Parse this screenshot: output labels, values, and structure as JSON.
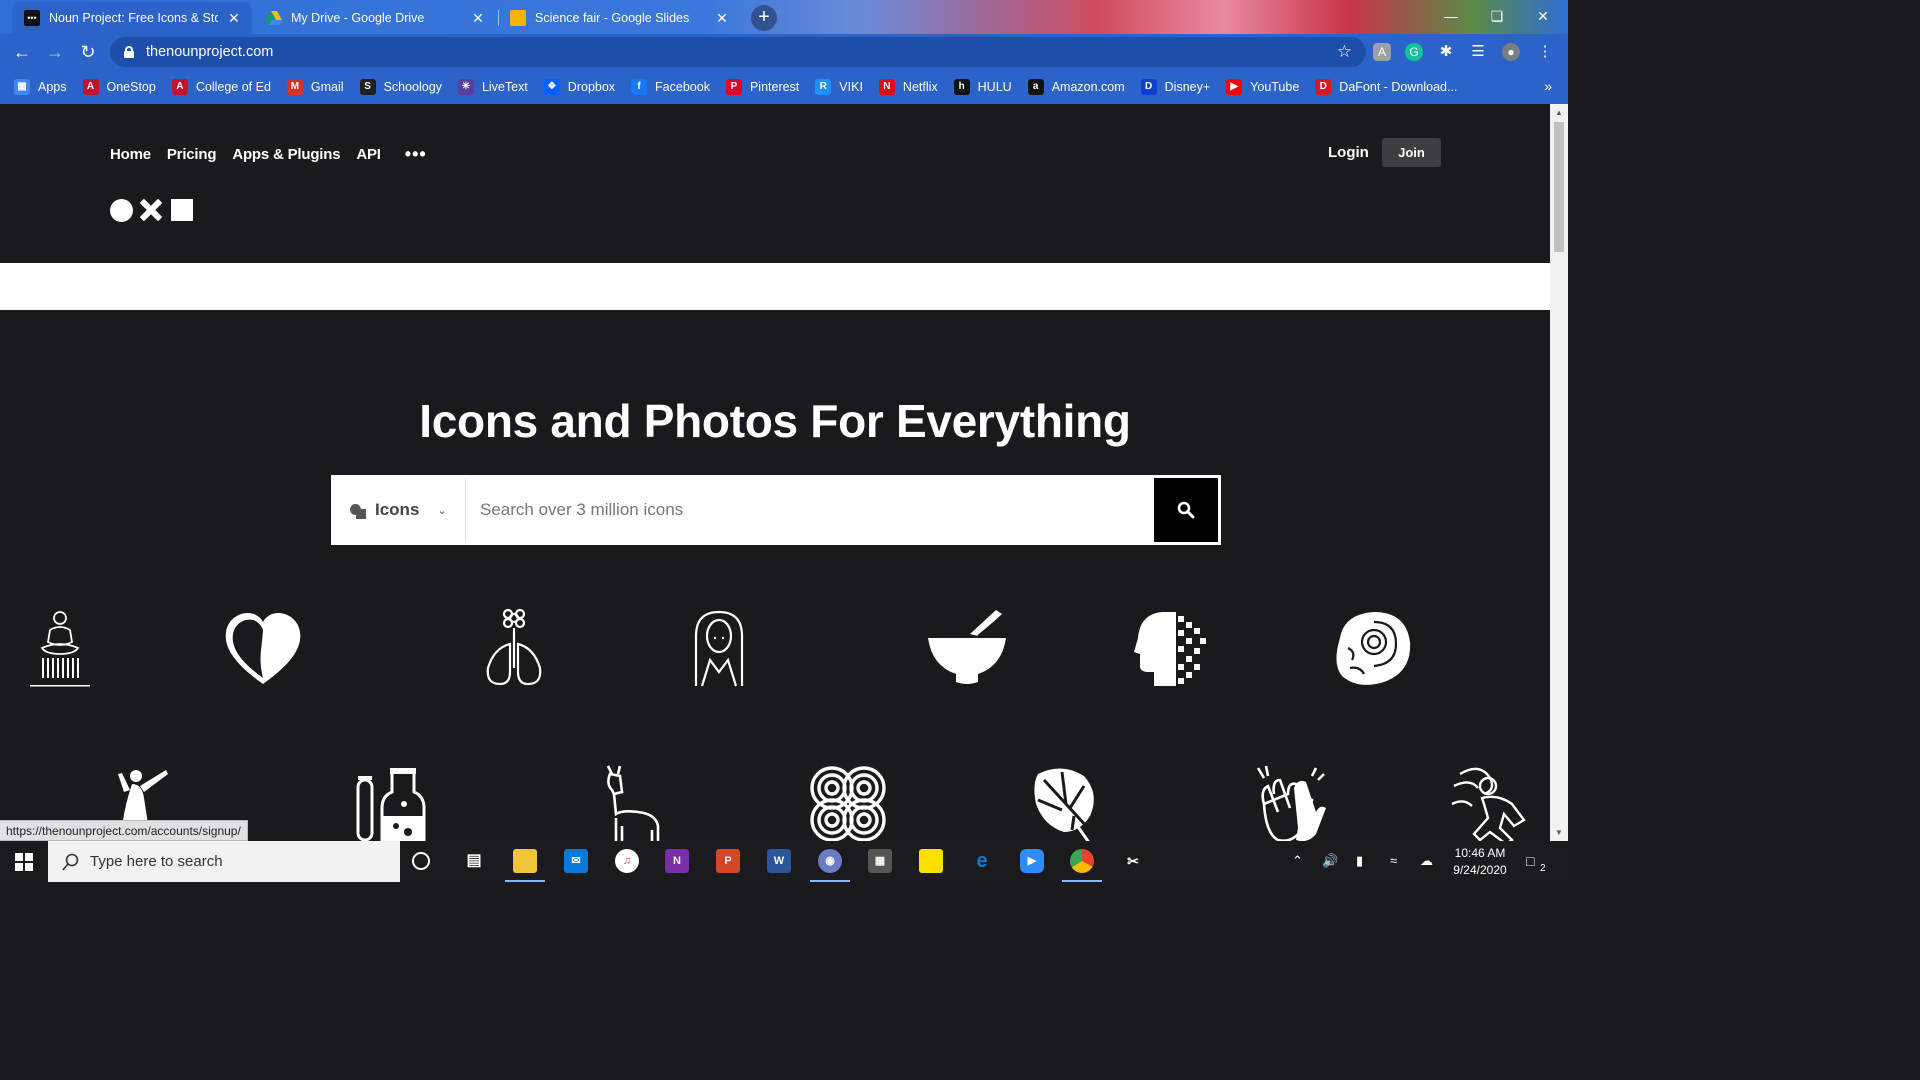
{
  "browser": {
    "tabs": [
      {
        "title": "Noun Project: Free Icons & Stock",
        "close": "✕"
      },
      {
        "title": "My Drive - Google Drive",
        "close": "✕"
      },
      {
        "title": "Science fair - Google Slides",
        "close": "✕"
      }
    ],
    "new_tab": "+",
    "address": "thenounproject.com",
    "bookmarks": [
      {
        "label": "Apps",
        "icon": "apps-grid-icon",
        "color": "#4285f4",
        "glyph": "▦"
      },
      {
        "label": "OneStop",
        "icon": "onestop-icon",
        "color": "#c8102e",
        "glyph": "A"
      },
      {
        "label": "College of Ed",
        "icon": "college-icon",
        "color": "#c8102e",
        "glyph": "A"
      },
      {
        "label": "Gmail",
        "icon": "gmail-icon",
        "color": "#d93025",
        "glyph": "M"
      },
      {
        "label": "Schoology",
        "icon": "schoology-icon",
        "color": "#1f1f1f",
        "glyph": "S"
      },
      {
        "label": "LiveText",
        "icon": "livetext-icon",
        "color": "#5b3fa0",
        "glyph": "✳"
      },
      {
        "label": "Dropbox",
        "icon": "dropbox-icon",
        "color": "#0061fe",
        "glyph": "❖"
      },
      {
        "label": "Facebook",
        "icon": "facebook-icon",
        "color": "#1877f2",
        "glyph": "f"
      },
      {
        "label": "Pinterest",
        "icon": "pinterest-icon",
        "color": "#e60023",
        "glyph": "P"
      },
      {
        "label": "VIKI",
        "icon": "viki-icon",
        "color": "#1e90ff",
        "glyph": "R"
      },
      {
        "label": "Netflix",
        "icon": "netflix-icon",
        "color": "#e50914",
        "glyph": "N"
      },
      {
        "label": "HULU",
        "icon": "hulu-icon",
        "color": "#111111",
        "glyph": "h"
      },
      {
        "label": "Amazon.com",
        "icon": "amazon-icon",
        "color": "#111111",
        "glyph": "a"
      },
      {
        "label": "Disney+",
        "icon": "disney-icon",
        "color": "#113ccf",
        "glyph": "D"
      },
      {
        "label": "YouTube",
        "icon": "youtube-icon",
        "color": "#ff0000",
        "glyph": "▶"
      },
      {
        "label": "DaFont - Download...",
        "icon": "dafont-icon",
        "color": "#d71920",
        "glyph": "D"
      }
    ],
    "bookmarks_more": "»"
  },
  "site": {
    "nav": [
      "Home",
      "Pricing",
      "Apps & Plugins",
      "API"
    ],
    "more": "•••",
    "login": "Login",
    "join": "Join",
    "hero_title": "Icons and Photos For Everything",
    "search": {
      "type_label": "Icons",
      "placeholder": "Search over 3 million icons"
    },
    "icons": [
      "meditation-icon",
      "heart-face-icon",
      "lungs-flower-icon",
      "woman-portrait-icon",
      "mortar-pestle-icon",
      "pixel-head-icon",
      "ammonite-icon",
      "dancer-icon",
      "test-tubes-icon",
      "llama-icon",
      "knot-pattern-icon",
      "monstera-leaf-icon",
      "clapping-hands-icon",
      "wind-person-icon"
    ]
  },
  "status_url": "https://thenounproject.com/accounts/signup/",
  "taskbar": {
    "search_placeholder": "Type here to search",
    "time": "10:46 AM",
    "date": "9/24/2020",
    "notifications": "2"
  }
}
